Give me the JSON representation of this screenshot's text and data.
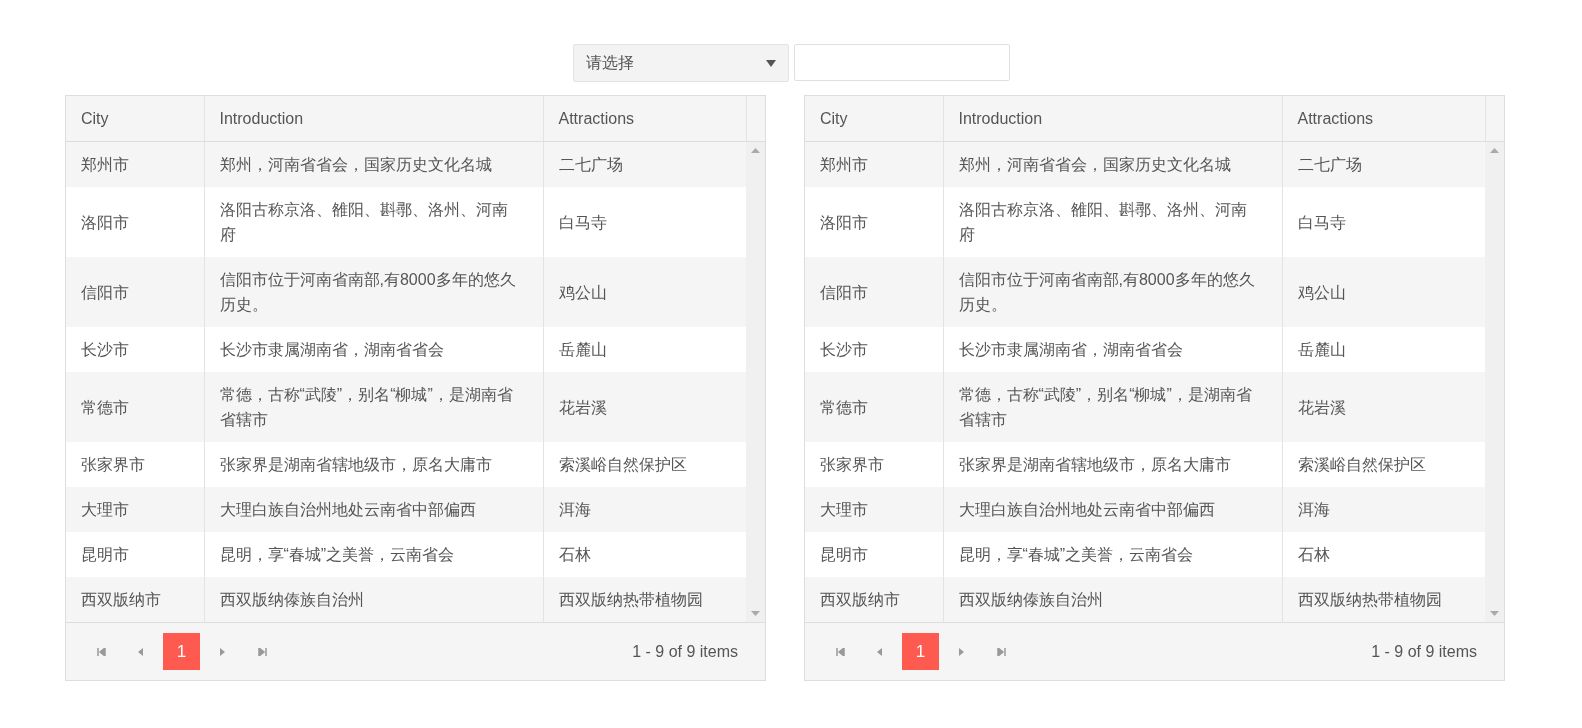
{
  "filter": {
    "select_value": "请选择"
  },
  "grids": [
    {
      "columns": [
        "City",
        "Introduction",
        "Attractions"
      ],
      "rows": [
        [
          "郑州市",
          "郑州，河南省省会，国家历史文化名城",
          "二七广场"
        ],
        [
          "洛阳市",
          "洛阳古称京洛、雒阳、斟鄩、洛州、河南府",
          "白马寺"
        ],
        [
          "信阳市",
          "信阳市位于河南省南部,有8000多年的悠久历史。",
          "鸡公山"
        ],
        [
          "长沙市",
          "长沙市隶属湖南省，湖南省省会",
          "岳麓山"
        ],
        [
          "常德市",
          "常德，古称“武陵”，别名“柳城”，是湖南省省辖市",
          "花岩溪"
        ],
        [
          "张家界市",
          "张家界是湖南省辖地级市，原名大庸市",
          "索溪峪自然保护区"
        ],
        [
          "大理市",
          "大理白族自治州地处云南省中部偏西",
          "洱海"
        ],
        [
          "昆明市",
          "昆明，享“春城”之美誉，云南省会",
          "石林"
        ],
        [
          "西双版纳市",
          "西双版纳傣族自治州",
          "西双版纳热带植物园"
        ]
      ],
      "pager": {
        "pages": [
          {
            "label": "1",
            "selected": true
          }
        ],
        "info": "1 - 9 of 9 items"
      }
    },
    {
      "columns": [
        "City",
        "Introduction",
        "Attractions"
      ],
      "rows": [
        [
          "郑州市",
          "郑州，河南省省会，国家历史文化名城",
          "二七广场"
        ],
        [
          "洛阳市",
          "洛阳古称京洛、雒阳、斟鄩、洛州、河南府",
          "白马寺"
        ],
        [
          "信阳市",
          "信阳市位于河南省南部,有8000多年的悠久历史。",
          "鸡公山"
        ],
        [
          "长沙市",
          "长沙市隶属湖南省，湖南省省会",
          "岳麓山"
        ],
        [
          "常德市",
          "常德，古称“武陵”，别名“柳城”，是湖南省省辖市",
          "花岩溪"
        ],
        [
          "张家界市",
          "张家界是湖南省辖地级市，原名大庸市",
          "索溪峪自然保护区"
        ],
        [
          "大理市",
          "大理白族自治州地处云南省中部偏西",
          "洱海"
        ],
        [
          "昆明市",
          "昆明，享“春城”之美誉，云南省会",
          "石林"
        ],
        [
          "西双版纳市",
          "西双版纳傣族自治州",
          "西双版纳热带植物园"
        ]
      ],
      "pager": {
        "pages": [
          {
            "label": "1",
            "selected": true
          }
        ],
        "info": "1 - 9 of 9 items"
      }
    }
  ]
}
